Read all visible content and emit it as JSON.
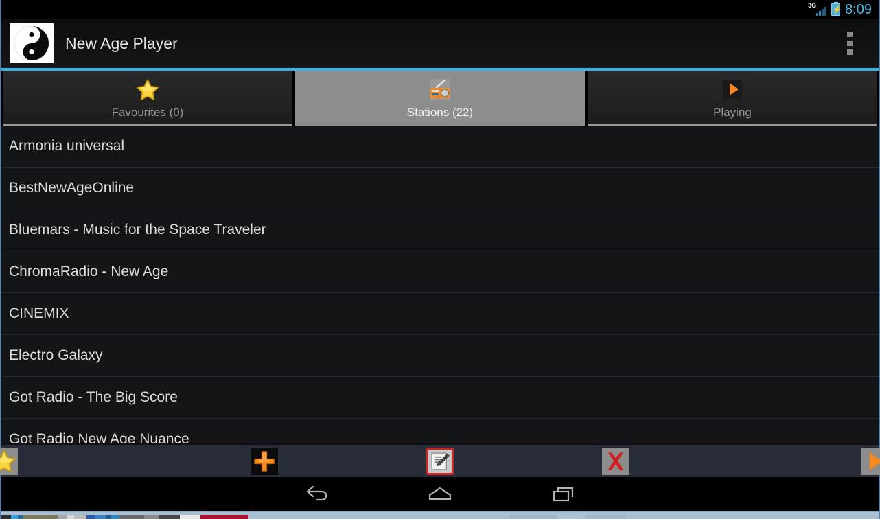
{
  "statusbar": {
    "network_label": "3G",
    "battery_icon": "battery-charging-icon",
    "signal_icon": "signal-3g-icon",
    "time": "8:09",
    "time_color": "#4ab8e8"
  },
  "actionbar": {
    "logo_icon": "yin-yang-logo-icon",
    "title": "New Age Player",
    "overflow_icon": "overflow-menu-icon"
  },
  "tabs": {
    "accent_color": "#33b5e5",
    "items": [
      {
        "label": "Favourites (0)",
        "icon": "star-icon",
        "selected": false
      },
      {
        "label": "Stations (22)",
        "icon": "radio-icon",
        "selected": true
      },
      {
        "label": "Playing",
        "icon": "play-icon",
        "selected": false
      }
    ]
  },
  "stations": {
    "items": [
      {
        "name": "Armonia universal"
      },
      {
        "name": "BestNewAgeOnline"
      },
      {
        "name": "Bluemars - Music for the Space Traveler"
      },
      {
        "name": "ChromaRadio - New Age"
      },
      {
        "name": "CINEMIX"
      },
      {
        "name": "Electro Galaxy"
      },
      {
        "name": "Got Radio - The Big Score"
      },
      {
        "name": "Got Radio New Age Nuance"
      }
    ]
  },
  "toolbar": {
    "buttons": [
      {
        "icon": "favourite-star-icon",
        "label": "Favourite",
        "focused": false
      },
      {
        "icon": "add-plus-icon",
        "label": "Add",
        "focused": false
      },
      {
        "icon": "edit-pencil-icon",
        "label": "Edit",
        "focused": true
      },
      {
        "icon": "delete-x-icon",
        "label": "Delete",
        "focused": false
      },
      {
        "icon": "play-icon",
        "label": "Play",
        "focused": false
      }
    ]
  },
  "navbar": {
    "buttons": [
      {
        "icon": "back-icon",
        "label": "Back"
      },
      {
        "icon": "home-icon",
        "label": "Home"
      },
      {
        "icon": "recents-icon",
        "label": "Recents"
      }
    ]
  },
  "colors": {
    "accent": "#33b5e5",
    "orange": "#f5881f",
    "star_gold": "#f2c824",
    "delete_red": "#d41f1f",
    "list_bg": "#131518",
    "toolbar_bg": "#282c38"
  }
}
